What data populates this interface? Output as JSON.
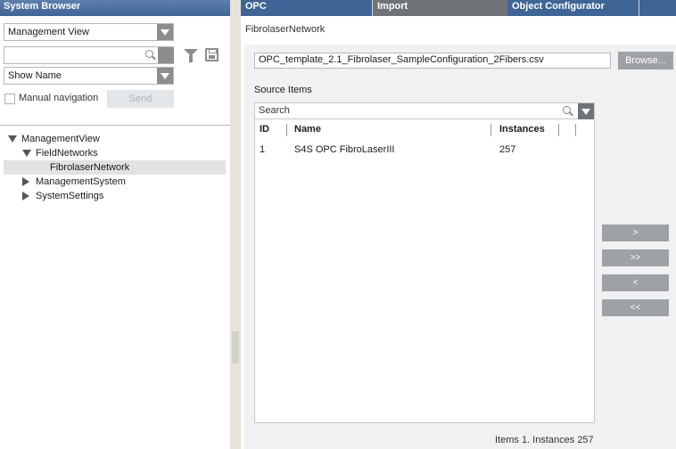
{
  "left_panel": {
    "title": "System Browser",
    "view_select": "Management View",
    "search_value": "",
    "display_select": "Show Name",
    "manual_navigation_label": "Manual navigation",
    "send_label": "Send",
    "tree": [
      {
        "label": "ManagementView",
        "expanded": true
      },
      {
        "label": "FieldNetworks",
        "expanded": true
      },
      {
        "label": "FibrolaserNetwork",
        "selected": true
      },
      {
        "label": "ManagementSystem",
        "expanded": false
      },
      {
        "label": "SystemSettings",
        "expanded": false
      }
    ]
  },
  "tabs": [
    {
      "label": "OPC"
    },
    {
      "label": "Import",
      "active": true
    },
    {
      "label": "Object Configurator"
    }
  ],
  "breadcrumb": "FibrolaserNetwork",
  "import": {
    "file_path": "OPC_template_2.1_Fibrolaser_SampleConfiguration_2Fibers.csv",
    "browse_label": "Browse...",
    "source_items_label": "Source Items",
    "search_placeholder": "Search",
    "columns": [
      "ID",
      "Name",
      "Instances"
    ],
    "rows": [
      {
        "id": "1",
        "name": "S4S OPC FibroLaserIII",
        "instances": "257"
      }
    ],
    "move_buttons": [
      ">",
      ">>",
      "<",
      "<<"
    ],
    "status": "Items 1. Instances 257"
  }
}
